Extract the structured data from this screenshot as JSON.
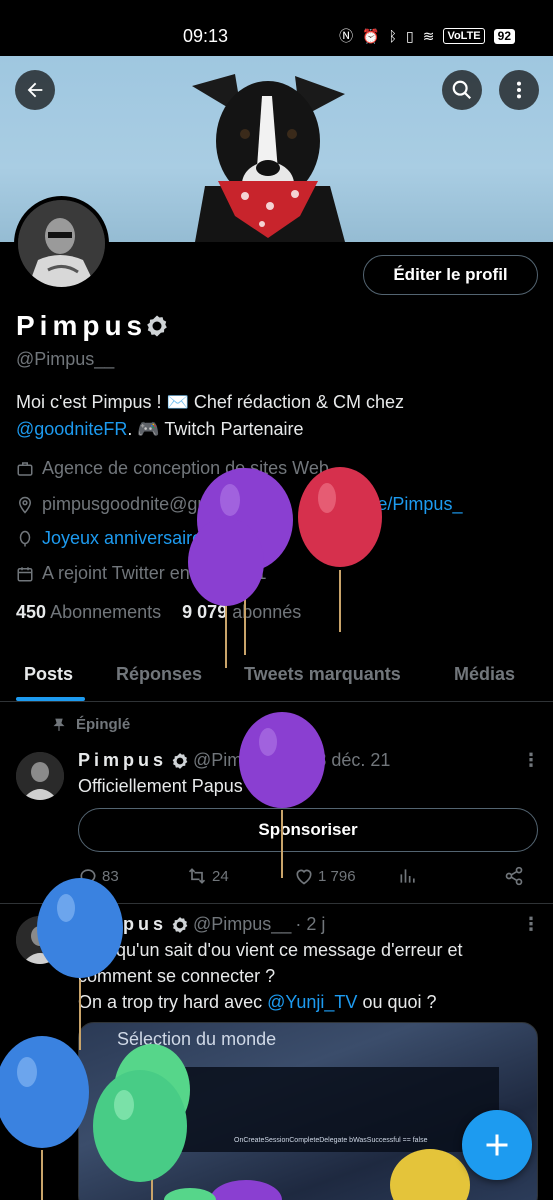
{
  "status_bar": {
    "time": "09:13",
    "network": "VoLTE",
    "battery": "92"
  },
  "header": {
    "back_icon": "arrow-left-icon",
    "search_icon": "search-icon",
    "more_icon": "more-vertical-icon"
  },
  "profile": {
    "edit_label": "Éditer le profil",
    "name": "Pimpus",
    "handle": "@Pimpus__",
    "bio_part1": "Moi c'est Pimpus ! ✉️ Chef rédaction & CM chez",
    "bio_link": "@goodniteFR",
    "bio_part2": ". 🎮 Twitch Partenaire",
    "category": "Agence de conception de sites Web",
    "location": "pimpusgoodnite@gmail.com",
    "website": "linktr.ee/Pimpus_",
    "birthday": "Joyeux anniversaire",
    "joined": "A rejoint Twitter en juin 2011",
    "following_count": "450",
    "following_label": "Abonnements",
    "followers_count": "9 079",
    "followers_label": "abonnés"
  },
  "tabs": [
    {
      "label": "Posts"
    },
    {
      "label": "Réponses"
    },
    {
      "label": "Tweets marquants"
    },
    {
      "label": "Médias"
    }
  ],
  "pinned_label": "Épinglé",
  "tweets": [
    {
      "name": "Pimpus",
      "handle": "@Pimpus__",
      "date": "· 18 déc. 21",
      "text": "Officiellement Papus 🥚❤️",
      "sponsor_label": "Sponsoriser",
      "replies": "83",
      "retweets": "24",
      "likes": "1 796"
    },
    {
      "name": "Pimpus",
      "handle": "@Pimpus__",
      "date": "· 2 j",
      "line1": "Quelqu'un sait d'ou vient ce message d'erreur et",
      "line2": "comment se connecter ?",
      "line3_part1": "On a trop try hard avec",
      "line3_link": "@Yunji_TV",
      "line3_part2": "ou quoi ?",
      "media_title": "Sélection du monde",
      "media_error": "OnCreateSessionCompleteDelegate bWasSuccessful == false"
    }
  ],
  "fab_icon": "plus-icon",
  "colors": {
    "accent": "#1d9bf0",
    "background": "#000000",
    "text_secondary": "#71767b"
  }
}
